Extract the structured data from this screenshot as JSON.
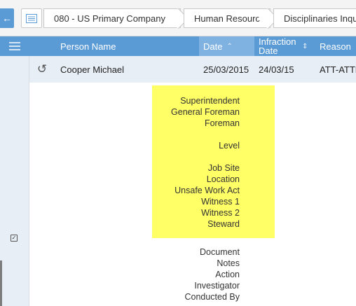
{
  "breadcrumb": {
    "back_icon": "arrow-left-icon",
    "list_icon": "list-icon",
    "company": "080 - US Primary Company",
    "company_icon": "arrow-down-icon",
    "module": "Human Resources",
    "page": "Disciplinaries Inquiry"
  },
  "grid": {
    "headers": {
      "person_name": "Person Name",
      "date": "Date",
      "infraction_date": "Infraction Date",
      "reason": "Reason"
    },
    "row": {
      "person_name": "Cooper Michael",
      "date": "25/03/2015",
      "infraction_date": "24/03/15",
      "reason": "ATT-ATTE"
    }
  },
  "detail_labels": {
    "highlighted": [
      "Superintendent",
      "General Foreman",
      "Foreman",
      "",
      "Level",
      "",
      "Job Site",
      "Location",
      "Unsafe Work Act",
      "Witness 1",
      "Witness 2",
      "Steward"
    ],
    "plain": [
      "Document",
      "Notes",
      "Action",
      "Investigator",
      "Conducted By"
    ]
  },
  "colors": {
    "header_blue": "#5b9bd5",
    "sorted_column": "#7fb2e1",
    "row_bg": "#e7eef5",
    "highlight": "#ffff66"
  }
}
